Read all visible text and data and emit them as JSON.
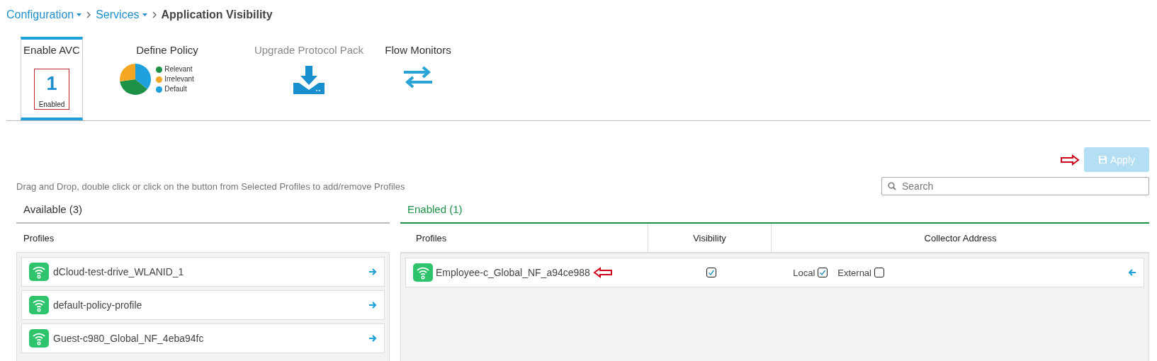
{
  "breadcrumb": [
    {
      "label": "Configuration",
      "kind": "dropdown"
    },
    {
      "label": "Services",
      "kind": "dropdown"
    },
    {
      "label": "Application Visibility",
      "kind": "current"
    }
  ],
  "tabs": [
    {
      "label": "Enable AVC",
      "selected": true,
      "disabled": false,
      "kind": "count",
      "value": "1",
      "caption": "Enabled"
    },
    {
      "label": "Define Policy",
      "selected": false,
      "disabled": false,
      "kind": "legend",
      "legend": [
        {
          "label": "Relevant",
          "color": "#1e9148"
        },
        {
          "label": "Irrelevant",
          "color": "#f5a623"
        },
        {
          "label": "Default",
          "color": "#1ea0dc"
        }
      ]
    },
    {
      "label": "Upgrade Protocol Pack",
      "selected": false,
      "disabled": true,
      "kind": "download"
    },
    {
      "label": "Flow Monitors",
      "selected": false,
      "disabled": false,
      "kind": "swap"
    }
  ],
  "apply": {
    "label": "Apply",
    "disabled": true
  },
  "hint": "Drag and Drop, double click or click on the button from Selected Profiles to add/remove Profiles",
  "search": {
    "placeholder": "Search"
  },
  "available": {
    "title": "Available (3)",
    "column": "Profiles",
    "profiles": [
      {
        "name": "dCloud-test-drive_WLANID_1"
      },
      {
        "name": "default-policy-profile"
      },
      {
        "name": "Guest-c980_Global_NF_4eba94fc"
      }
    ]
  },
  "enabled": {
    "title": "Enabled (1)",
    "columns": [
      "Profiles",
      "Visibility",
      "Collector Address"
    ],
    "profiles": [
      {
        "name": "Employee-c_Global_NF_a94ce988",
        "visibility": true,
        "local_label": "Local",
        "local": true,
        "external_label": "External",
        "external": false
      }
    ]
  }
}
